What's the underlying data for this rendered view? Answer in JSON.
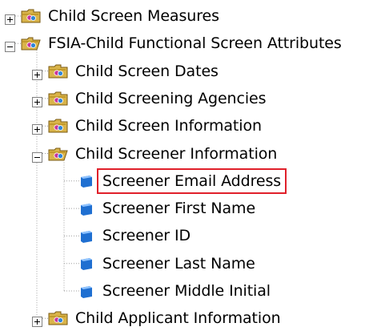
{
  "tree": [
    {
      "label": "Child Screen Measures",
      "level": 0,
      "type": "folder",
      "expanded": false,
      "selected": false
    },
    {
      "label": "FSIA-Child Functional Screen Attributes",
      "level": 0,
      "type": "folder",
      "expanded": true,
      "selected": false
    },
    {
      "label": "Child Screen Dates",
      "level": 1,
      "type": "folder",
      "expanded": false,
      "selected": false
    },
    {
      "label": "Child Screening Agencies",
      "level": 1,
      "type": "folder",
      "expanded": false,
      "selected": false
    },
    {
      "label": "Child Screen Information",
      "level": 1,
      "type": "folder",
      "expanded": false,
      "selected": false
    },
    {
      "label": "Child Screener Information",
      "level": 1,
      "type": "folder",
      "expanded": true,
      "selected": false
    },
    {
      "label": "Screener Email Address",
      "level": 2,
      "type": "item",
      "selected": true
    },
    {
      "label": "Screener First Name",
      "level": 2,
      "type": "item",
      "selected": false
    },
    {
      "label": "Screener ID",
      "level": 2,
      "type": "item",
      "selected": false
    },
    {
      "label": "Screener Last Name",
      "level": 2,
      "type": "item",
      "selected": false
    },
    {
      "label": "Screener Middle Initial",
      "level": 2,
      "type": "item",
      "selected": false
    },
    {
      "label": "Child Applicant Information",
      "level": 1,
      "type": "folder",
      "expanded": false,
      "selected": false
    }
  ],
  "colors": {
    "folder_body": "#d9b44a",
    "folder_tab": "#c39a2b",
    "folder_edge": "#7a5a12",
    "badge_magenta": "#c8369b",
    "badge_blue": "#2f86d8",
    "item_icon": "#1f6fd1",
    "item_icon_light": "#8fc3ff",
    "selection_border": "#e0202a",
    "tree_line": "#a0a0a0",
    "expander_border": "#808080"
  }
}
